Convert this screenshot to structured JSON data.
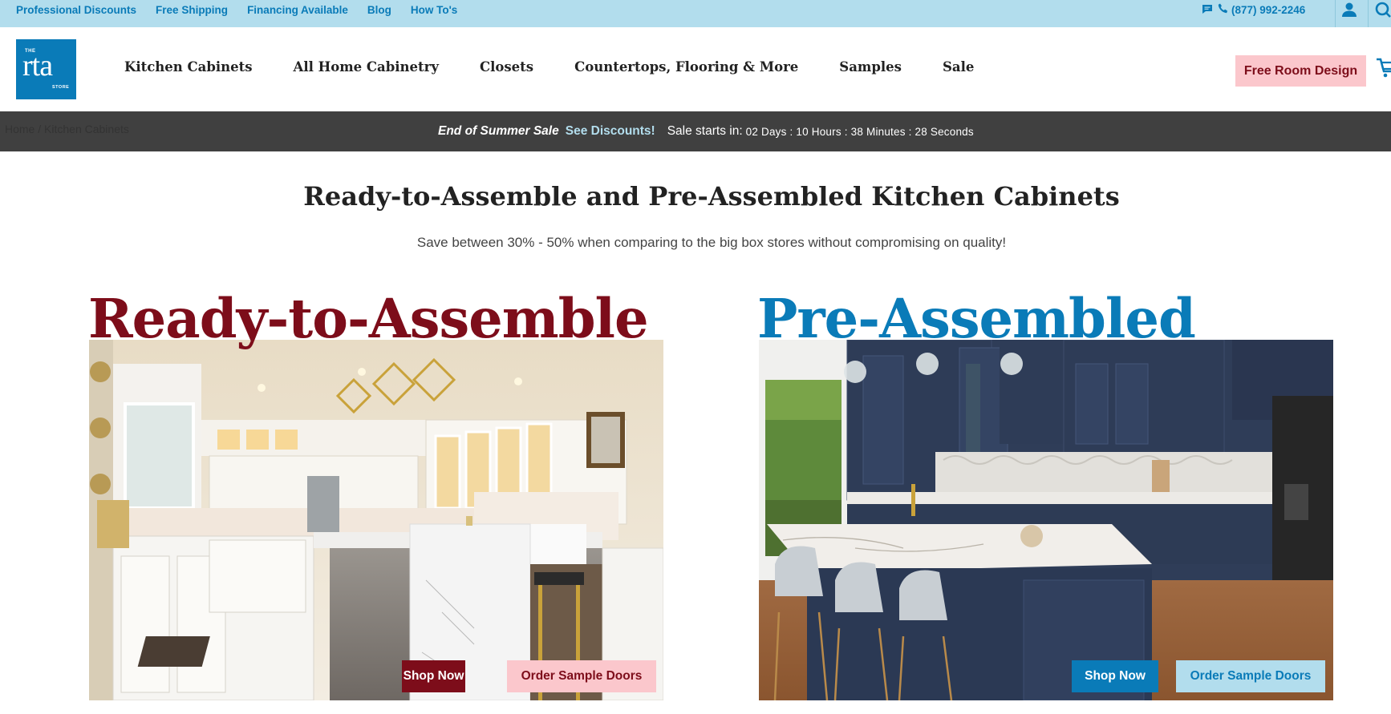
{
  "colors": {
    "top_bar": "#b2dded",
    "brand_blue": "#0a7bb8",
    "brand_red": "#7d0d1a",
    "pink": "#fbc7cc",
    "promo_bg": "#404040"
  },
  "top_links": [
    "Professional Discounts",
    "Free Shipping",
    "Financing Available",
    "Blog",
    "How To's"
  ],
  "contact": {
    "phone": "(877) 992-2246",
    "chat_icon": "chat-bubble-icon",
    "phone_icon": "phone-icon",
    "account_icon": "user-icon",
    "search_icon": "search-icon"
  },
  "logo": {
    "the": "THE",
    "name": "rta",
    "store": "STORE"
  },
  "nav": [
    {
      "label": "Kitchen Cabinets"
    },
    {
      "label": "All Home Cabinetry"
    },
    {
      "label": "Closets"
    },
    {
      "label": "Countertops, Flooring & More"
    },
    {
      "label": "Samples"
    },
    {
      "label": "Sale"
    }
  ],
  "header": {
    "cta": "Free Room Design",
    "cart_icon": "cart-icon"
  },
  "breadcrumb": {
    "home": "Home",
    "separator": "/",
    "current": "Kitchen Cabinets"
  },
  "promo": {
    "title": "End of Summer Sale",
    "link": "See Discounts!",
    "starts": "Sale starts in:",
    "countdown": "02 Days : 10 Hours : 38 Minutes : 28 Seconds"
  },
  "page": {
    "title": "Ready-to-Assemble and Pre-Assembled Kitchen Cabinets",
    "subtitle": "Save between 30% - 50% when comparing to the big box stores without compromising on quality!"
  },
  "panels": [
    {
      "title": "Ready-to-Assemble",
      "shop": "Shop Now",
      "samples": "Order Sample Doors"
    },
    {
      "title": "Pre-Assembled",
      "shop": "Shop Now",
      "samples": "Order Sample Doors"
    }
  ]
}
